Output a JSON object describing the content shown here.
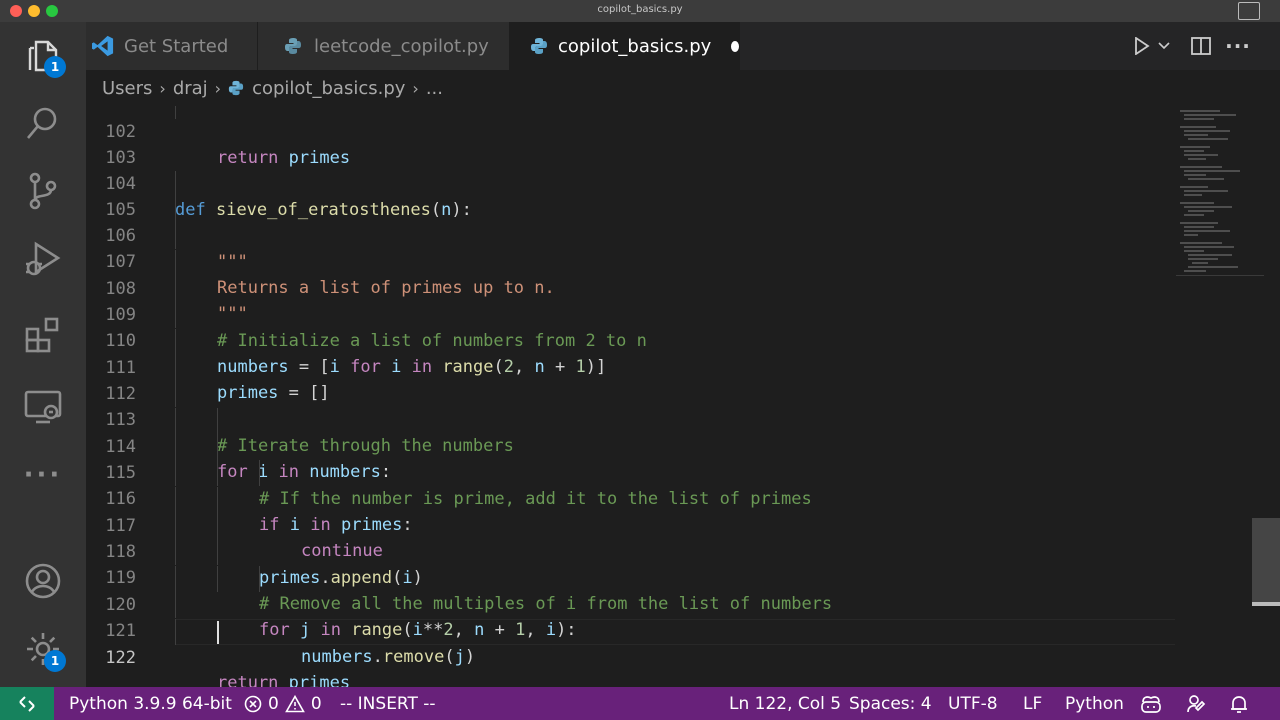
{
  "window": {
    "title": "copilot_basics.py",
    "traffic_lights": [
      "#ff5f57",
      "#febc2e",
      "#28c840"
    ]
  },
  "activity_bar": {
    "items": [
      {
        "name": "explorer",
        "icon": "files-icon",
        "badge": "1"
      },
      {
        "name": "search",
        "icon": "search-icon"
      },
      {
        "name": "source-control",
        "icon": "source-control-icon"
      },
      {
        "name": "run-and-debug",
        "icon": "run-debug-icon"
      },
      {
        "name": "extensions",
        "icon": "extensions-icon"
      },
      {
        "name": "remote-explorer",
        "icon": "remote-explorer-icon"
      },
      {
        "name": "more",
        "icon": "ellipsis-icon"
      }
    ],
    "bottom": [
      {
        "name": "accounts",
        "icon": "account-icon"
      },
      {
        "name": "manage",
        "icon": "gear-icon",
        "badge": "1"
      }
    ]
  },
  "tabs": [
    {
      "label": "Get Started",
      "icon": "vscode-logo-icon",
      "active": false
    },
    {
      "label": "leetcode_copilot.py",
      "icon": "python-icon",
      "active": false
    },
    {
      "label": "copilot_basics.py",
      "icon": "python-icon",
      "active": true,
      "dirty": true
    }
  ],
  "tab_actions": [
    "run-icon",
    "chevron-down-icon",
    "split-editor-icon",
    "more-actions-icon"
  ],
  "breadcrumb": {
    "parts": [
      "Users",
      "draj",
      "copilot_basics.py",
      "..."
    ]
  },
  "editor": {
    "current_line": "122",
    "code_lines": [
      {
        "n": "102",
        "text": "return primes"
      },
      {
        "n": "103",
        "text": ""
      },
      {
        "n": "104",
        "text": "def sieve_of_eratosthenes(n):"
      },
      {
        "n": "105",
        "text": "\"\"\""
      },
      {
        "n": "106",
        "text": "Returns a list of primes up to n."
      },
      {
        "n": "107",
        "text": "\"\"\""
      },
      {
        "n": "108",
        "text": "# Initialize a list of numbers from 2 to n"
      },
      {
        "n": "109",
        "text": "numbers = [i for i in range(2, n + 1)]"
      },
      {
        "n": "110",
        "text": "primes = []"
      },
      {
        "n": "111",
        "text": ""
      },
      {
        "n": "112",
        "text": "# Iterate through the numbers"
      },
      {
        "n": "113",
        "text": "for i in numbers:"
      },
      {
        "n": "114",
        "text": "# If the number is prime, add it to the list of primes"
      },
      {
        "n": "115",
        "text": "if i in primes:"
      },
      {
        "n": "116",
        "text": "continue"
      },
      {
        "n": "117",
        "text": "primes.append(i)"
      },
      {
        "n": "118",
        "text": "# Remove all the multiples of i from the list of numbers"
      },
      {
        "n": "119",
        "text": "for j in range(i**2, n + 1, i):"
      },
      {
        "n": "120",
        "text": "numbers.remove(j)"
      },
      {
        "n": "121",
        "text": "return primes"
      },
      {
        "n": "122",
        "text": ""
      }
    ]
  },
  "statusbar": {
    "interpreter": "Python 3.9.9 64-bit",
    "errors": "0",
    "warnings": "0",
    "mode": "-- INSERT --",
    "position": "Ln 122, Col 5",
    "spaces": "Spaces: 4",
    "encoding": "UTF-8",
    "eol": "LF",
    "language": "Python",
    "colors": {
      "bar": "#68217a",
      "remote": "#16825d"
    }
  }
}
